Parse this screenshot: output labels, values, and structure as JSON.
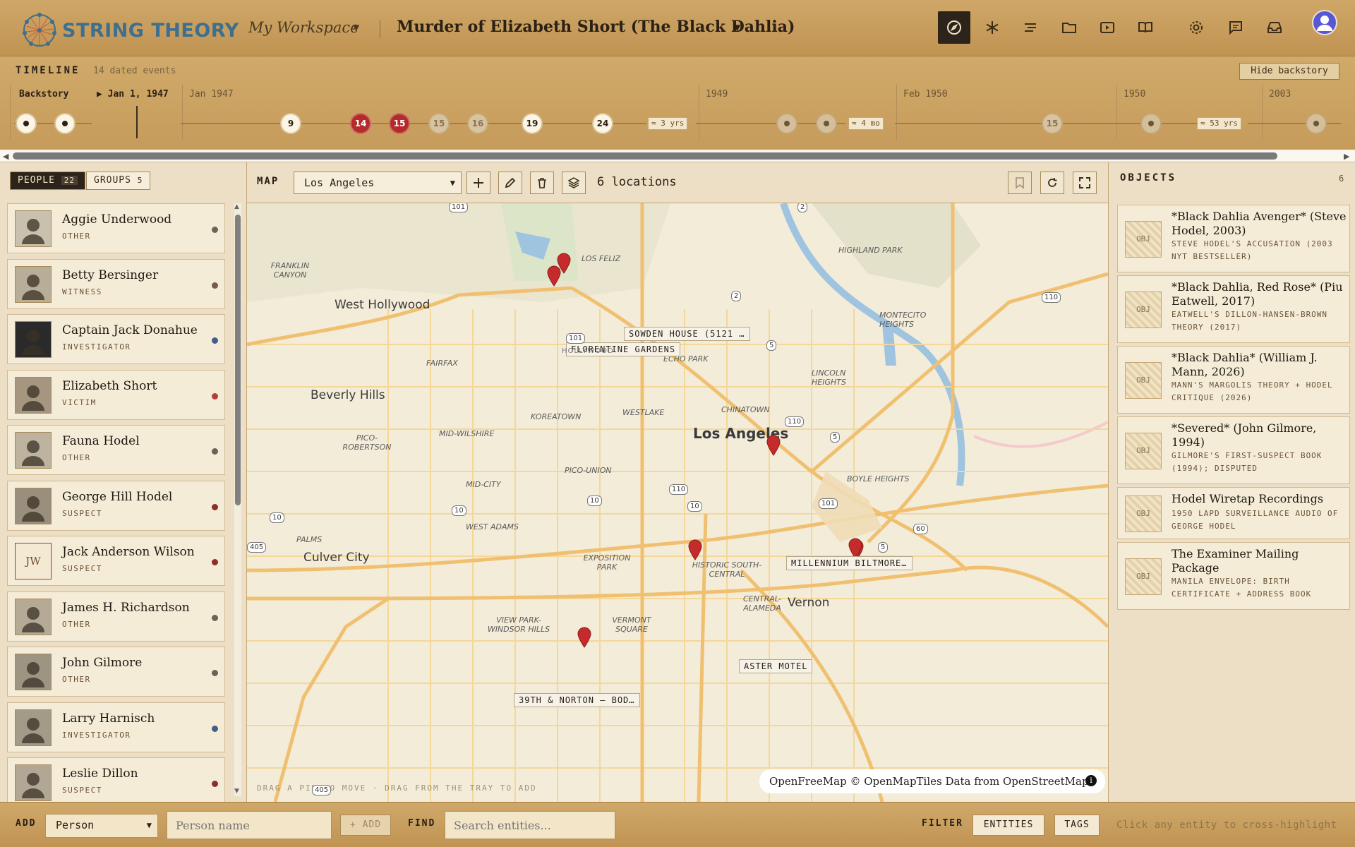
{
  "app": {
    "name": "STRING THEORY",
    "workspace": "My Workspace",
    "case_title": "Murder of Elizabeth Short (The Black Dahlia)"
  },
  "toolbar": {
    "icons": [
      "compass-icon",
      "asterisk-icon",
      "list-icon",
      "folder-icon",
      "play-icon",
      "book-icon",
      "gear-icon",
      "chat-icon",
      "inbox-icon",
      "user-avatar"
    ]
  },
  "timeline": {
    "label": "TIMELINE",
    "count": "14 dated events",
    "hide_button": "Hide backstory",
    "headers": {
      "backstory": "Backstory",
      "start": "▶ Jan 1, 1947",
      "jan1947": "Jan 1947",
      "y1949": "1949",
      "feb1950": "Feb 1950",
      "y1950": "1950",
      "y2003": "2003"
    },
    "nodes": [
      "9",
      "14",
      "15",
      "15",
      "16",
      "19",
      "24",
      "15"
    ],
    "gaps": [
      "≈ 3 yrs",
      "≈ 4 mo",
      "≈ 53 yrs"
    ]
  },
  "left": {
    "tabs": {
      "people": "PEOPLE",
      "people_count": "22",
      "groups": "GROUPS",
      "groups_count": "5"
    },
    "people": [
      {
        "name": "Aggie Underwood",
        "role": "OTHER",
        "color": "#6b6357"
      },
      {
        "name": "Betty Bersinger",
        "role": "WITNESS",
        "color": "#7a5a48"
      },
      {
        "name": "Captain Jack Donahue",
        "role": "INVESTIGATOR",
        "color": "#3f5f8a"
      },
      {
        "name": "Elizabeth Short",
        "role": "VICTIM",
        "color": "#b0413a"
      },
      {
        "name": "Fauna Hodel",
        "role": "OTHER",
        "color": "#6b6357"
      },
      {
        "name": "George Hill Hodel",
        "role": "SUSPECT",
        "color": "#8a2f2a"
      },
      {
        "name": "Jack Anderson Wilson",
        "role": "SUSPECT",
        "color": "#8a2f2a",
        "initials": "JW"
      },
      {
        "name": "James H. Richardson",
        "role": "OTHER",
        "color": "#6b6357"
      },
      {
        "name": "John Gilmore",
        "role": "OTHER",
        "color": "#6b6357"
      },
      {
        "name": "Larry Harnisch",
        "role": "INVESTIGATOR",
        "color": "#3f5f8a"
      },
      {
        "name": "Leslie Dillon",
        "role": "SUSPECT",
        "color": "#8a2f2a"
      }
    ]
  },
  "map": {
    "label": "MAP",
    "city": "Los Angeles",
    "locations": "6 locations",
    "attribution": "OpenFreeMap © OpenMapTiles Data from OpenStreetMap",
    "drag_hint": "DRAG A PIN TO MOVE · DRAG FROM THE TRAY TO ADD",
    "pins": [
      "SOWDEN HOUSE (5121 …",
      "FLORENTINE GARDENS",
      "MILLENNIUM BILTMORE…",
      "ASTER MOTEL",
      "39TH & NORTON — BOD…"
    ],
    "places": {
      "west_hollywood": "West Hollywood",
      "beverly_hills": "Beverly Hills",
      "culver_city": "Culver City",
      "los_angeles": "Los Angeles",
      "vernon": "Vernon",
      "franklin_canyon": "FRANKLIN CANYON",
      "los_feliz": "LOS FELIZ",
      "highland_park": "HIGHLAND PARK",
      "montecito_heights": "MONTECITO HEIGHTS",
      "echo_park": "ECHO PARK",
      "lincoln_heights": "LINCOLN HEIGHTS",
      "chinatown": "CHINATOWN",
      "westlake": "WESTLAKE",
      "koreatown": "KOREATOWN",
      "fairfax": "FAIRFAX",
      "mid_wilshire": "MID-WILSHIRE",
      "pico_robertson": "PICO-ROBERTSON",
      "pico_union": "PICO-UNION",
      "mid_city": "MID-CITY",
      "west_adams": "WEST ADAMS",
      "palms": "PALMS",
      "exposition_park": "EXPOSITION PARK",
      "historic_south_central": "HISTORIC SOUTH-CENTRAL",
      "boyle_heights": "BOYLE HEIGHTS",
      "view_park": "VIEW PARK-WINDSOR HILLS",
      "vermont_square": "VERMONT SQUARE",
      "central_alameda": "CENTRAL-ALAMEDA",
      "hollywood": "HOLLYWOOD"
    },
    "shields": [
      "101",
      "2",
      "110",
      "5",
      "101",
      "2",
      "110",
      "5",
      "110",
      "10",
      "101",
      "10",
      "10",
      "60",
      "405",
      "405",
      "5",
      "10"
    ]
  },
  "objects": {
    "label": "OBJECTS",
    "count": "6",
    "thumb": "OBJ",
    "items": [
      {
        "title": "*Black Dahlia Avenger* (Steve Hodel, 2003)",
        "desc": "STEVE HODEL'S ACCUSATION (2003 NYT BESTSELLER)"
      },
      {
        "title": "*Black Dahlia, Red Rose* (Piu Eatwell, 2017)",
        "desc": "EATWELL'S DILLON-HANSEN-BROWN THEORY (2017)"
      },
      {
        "title": "*Black Dahlia* (William J. Mann, 2026)",
        "desc": "MANN'S MARGOLIS THEORY + HODEL CRITIQUE (2026)"
      },
      {
        "title": "*Severed* (John Gilmore, 1994)",
        "desc": "GILMORE'S FIRST-SUSPECT BOOK (1994); DISPUTED"
      },
      {
        "title": "Hodel Wiretap Recordings",
        "desc": "1950 LAPD SURVEILLANCE AUDIO OF GEORGE HODEL"
      },
      {
        "title": "The Examiner Mailing Package",
        "desc": "MANILA ENVELOPE: BIRTH CERTIFICATE + ADDRESS BOOK"
      }
    ]
  },
  "bottom": {
    "add_label": "ADD",
    "add_type": "Person",
    "name_placeholder": "Person name",
    "add_button": "+ ADD",
    "find_label": "FIND",
    "find_placeholder": "Search entities...",
    "filter_label": "FILTER",
    "entities": "ENTITIES",
    "tags": "TAGS",
    "hint": "Click any entity to cross-highlight"
  }
}
